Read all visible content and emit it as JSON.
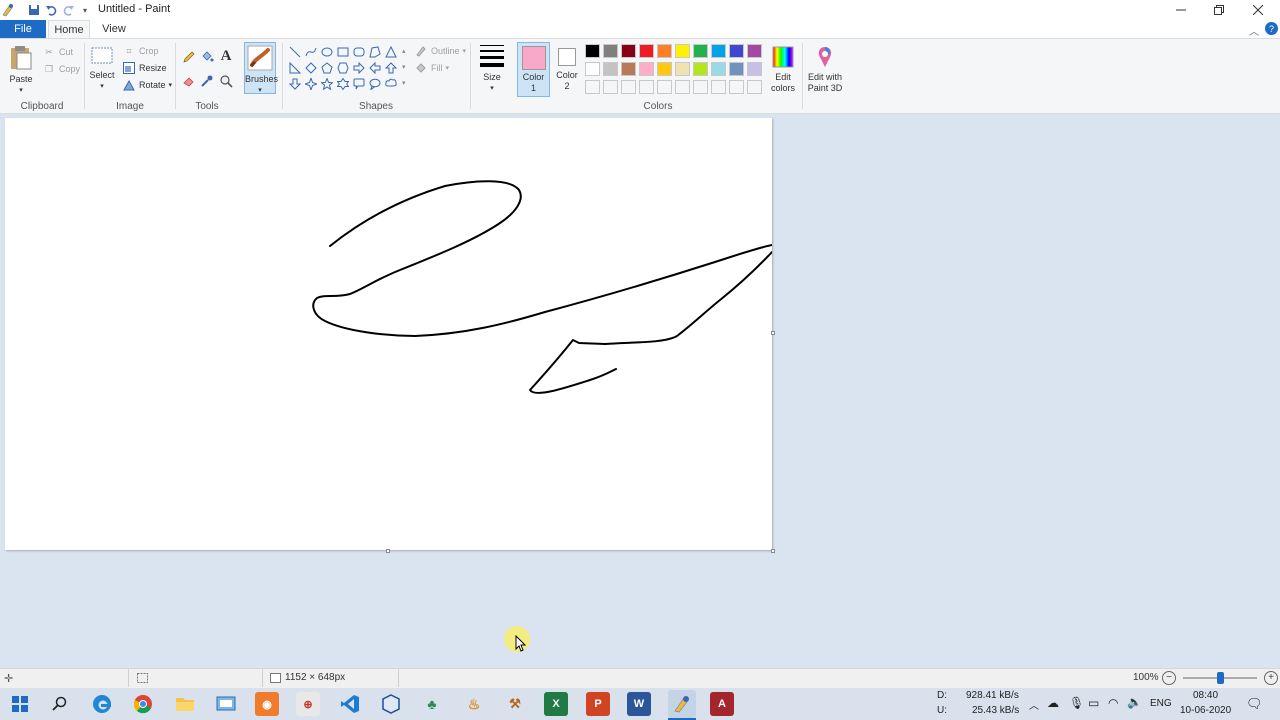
{
  "window": {
    "title": "Untitled - Paint",
    "controls": [
      "minimize",
      "restore",
      "close"
    ]
  },
  "tabs": {
    "file": "File",
    "home": "Home",
    "view": "View"
  },
  "ribbon": {
    "clipboard": {
      "label": "Clipboard",
      "paste": "Paste",
      "cut": "Cut",
      "copy": "Copy"
    },
    "image": {
      "label": "Image",
      "select": "Select",
      "crop": "Crop",
      "resize": "Resize",
      "rotate": "Rotate"
    },
    "tools": {
      "label": "Tools"
    },
    "brushes": {
      "label": "Brushes"
    },
    "shapes": {
      "label": "Shapes",
      "outline": "Outline",
      "fill": "Fill"
    },
    "size": {
      "label": "Size"
    },
    "colors": {
      "label": "Colors",
      "color1_label": "Color\n1",
      "color2_label": "Color\n2",
      "color1": "#f9a8c9",
      "color2": "#ffffff",
      "edit_colors": "Edit colors",
      "paint3d": "Edit with Paint 3D",
      "palette_row1": [
        "#000000",
        "#7f7f7f",
        "#880015",
        "#ed1c24",
        "#ff7f27",
        "#fff200",
        "#22b14c",
        "#00a2e8",
        "#3f48cc",
        "#a349a4"
      ],
      "palette_row2": [
        "#ffffff",
        "#c3c3c3",
        "#b97a57",
        "#ffaec9",
        "#ffc90e",
        "#efe4b0",
        "#b5e61d",
        "#99d9ea",
        "#7092be",
        "#c8bfe7"
      ]
    }
  },
  "status": {
    "image_size": "1152 × 648px",
    "zoom": "100%",
    "zoom_fraction": 0.5
  },
  "taskbar": {
    "net_down_label": "D:",
    "net_down": "928.41 kB/s",
    "net_up_label": "U:",
    "net_up": "25.43 kB/s",
    "lang": "ENG",
    "time": "08:40",
    "date": "10-06-2020"
  }
}
